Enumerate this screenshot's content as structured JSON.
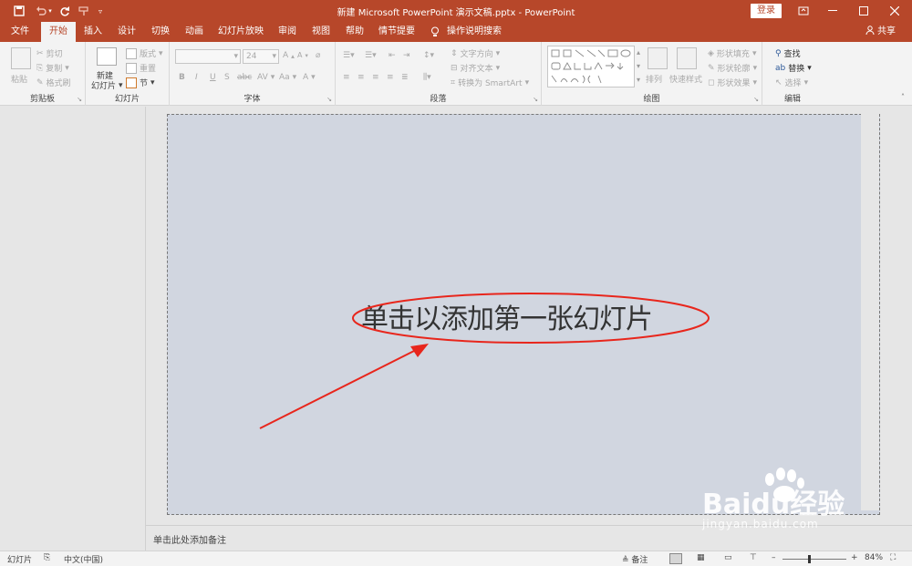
{
  "titlebar": {
    "title": "新建 Microsoft PowerPoint 演示文稿.pptx - PowerPoint",
    "login": "登录",
    "save_icon": "save-icon",
    "undo_icon": "undo-icon",
    "redo_icon": "redo-icon"
  },
  "tabs": [
    "文件",
    "开始",
    "插入",
    "设计",
    "切换",
    "动画",
    "幻灯片放映",
    "审阅",
    "视图",
    "帮助",
    "情节提要",
    "操作说明搜索"
  ],
  "share": "共享",
  "ribbon": {
    "clipboard": {
      "label": "剪贴板",
      "paste": "粘贴",
      "cut": "剪切",
      "copy": "复制",
      "format_painter": "格式刷"
    },
    "slides": {
      "label": "幻灯片",
      "new_slide_1": "新建",
      "new_slide_2": "幻灯片",
      "layout": "版式",
      "reset": "重置",
      "section": "节"
    },
    "font": {
      "label": "字体",
      "size": "24",
      "bold": "B",
      "italic": "I",
      "underline": "U",
      "strike": "S",
      "abc": "abc",
      "grow": "A",
      "shrink": "A",
      "spacing": "AV",
      "case": "Aa",
      "color": "A"
    },
    "paragraph": {
      "label": "段落",
      "text_direction": "文字方向",
      "align_text": "对齐文本",
      "smartart": "转换为 SmartArt"
    },
    "drawing": {
      "label": "绘图",
      "arrange": "排列",
      "quick_styles": "快速样式",
      "shape_fill": "形状填充",
      "shape_outline": "形状轮廓",
      "shape_effects": "形状效果"
    },
    "editing": {
      "label": "编辑",
      "find": "查找",
      "replace": "替换",
      "select": "选择"
    }
  },
  "slide": {
    "placeholder": "单击以添加第一张幻灯片"
  },
  "notes": {
    "placeholder": "单击此处添加备注"
  },
  "statusbar": {
    "slide_label": "幻灯片",
    "language": "中文(中国)",
    "notes": "备注",
    "zoom_minus": "–",
    "zoom_plus": "+",
    "zoom": "84%"
  },
  "watermark": {
    "main": "Baidu经验",
    "sub": "jingyan.baidu.com"
  },
  "colors": {
    "accent": "#b7472a",
    "slide_bg": "#d1d6e0",
    "annotation": "#e8261c"
  }
}
